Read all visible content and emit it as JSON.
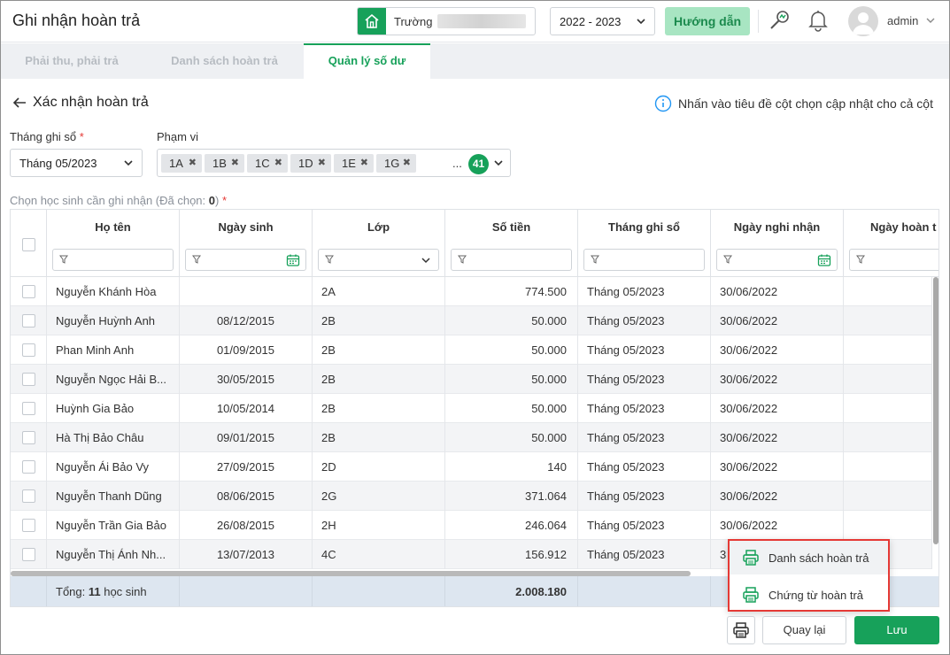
{
  "header": {
    "title": "Ghi nhận hoàn trả",
    "school_label": "Trường",
    "year": "2022 - 2023",
    "guide_label": "Hướng dẫn",
    "user": "admin"
  },
  "tabs": [
    {
      "label": "Phải thu, phải trả",
      "active": false
    },
    {
      "label": "Danh sách hoàn trả",
      "active": false
    },
    {
      "label": "Quản lý số dư",
      "active": true
    }
  ],
  "page": {
    "back_title": "Xác nhận hoàn trả",
    "hint": "Nhấn vào tiêu đề cột chọn cập nhật cho cả cột",
    "month_label": "Tháng ghi sổ",
    "month_required": "*",
    "month_value": "Tháng 05/2023",
    "scope_label": "Phạm vi",
    "scope_chips": [
      "1A",
      "1B",
      "1C",
      "1D",
      "1E",
      "1G"
    ],
    "scope_more": "...",
    "scope_count": "41",
    "choose_label_prefix": "Chọn học sinh cần ghi nhận (Đã chọn: ",
    "choose_count": "0",
    "choose_label_suffix": ")",
    "choose_required": "*"
  },
  "table": {
    "columns": [
      "Họ tên",
      "Ngày sinh",
      "Lớp",
      "Số tiền",
      "Tháng ghi sổ",
      "Ngày nghi nhận",
      "Ngày hoàn t"
    ],
    "rows": [
      {
        "name": "Nguyễn Khánh Hòa",
        "dob": "",
        "class": "2A",
        "amount": "774.500",
        "month": "Tháng 05/2023",
        "date": "30/06/2022"
      },
      {
        "name": "Nguyễn Huỳnh Anh",
        "dob": "08/12/2015",
        "class": "2B",
        "amount": "50.000",
        "month": "Tháng 05/2023",
        "date": "30/06/2022"
      },
      {
        "name": "Phan Minh Anh",
        "dob": "01/09/2015",
        "class": "2B",
        "amount": "50.000",
        "month": "Tháng 05/2023",
        "date": "30/06/2022"
      },
      {
        "name": "Nguyễn Ngọc Hải B...",
        "dob": "30/05/2015",
        "class": "2B",
        "amount": "50.000",
        "month": "Tháng 05/2023",
        "date": "30/06/2022"
      },
      {
        "name": "Huỳnh Gia Bảo",
        "dob": "10/05/2014",
        "class": "2B",
        "amount": "50.000",
        "month": "Tháng 05/2023",
        "date": "30/06/2022"
      },
      {
        "name": "Hà Thị Bảo Châu",
        "dob": "09/01/2015",
        "class": "2B",
        "amount": "50.000",
        "month": "Tháng 05/2023",
        "date": "30/06/2022"
      },
      {
        "name": "Nguyễn Ái Bảo Vy",
        "dob": "27/09/2015",
        "class": "2D",
        "amount": "140",
        "month": "Tháng 05/2023",
        "date": "30/06/2022"
      },
      {
        "name": "Nguyễn Thanh Dũng",
        "dob": "08/06/2015",
        "class": "2G",
        "amount": "371.064",
        "month": "Tháng 05/2023",
        "date": "30/06/2022"
      },
      {
        "name": "Nguyễn Trần Gia Bảo",
        "dob": "26/08/2015",
        "class": "2H",
        "amount": "246.064",
        "month": "Tháng 05/2023",
        "date": "30/06/2022"
      },
      {
        "name": "Nguyễn Thị Ánh Nh...",
        "dob": "13/07/2013",
        "class": "4C",
        "amount": "156.912",
        "month": "Tháng 05/2023",
        "date": "3"
      }
    ],
    "total_prefix": "Tổng: ",
    "total_count": "11",
    "total_suffix": " học sinh",
    "total_amount": "2.008.180"
  },
  "print_menu": [
    "Danh sách hoàn trả",
    "Chứng từ hoàn trả"
  ],
  "buttons": {
    "back": "Quay lại",
    "save": "Lưu"
  },
  "colors": {
    "primary": "#17a15a",
    "guide_bg": "#a8e5c2",
    "highlight_border": "#e53935"
  }
}
